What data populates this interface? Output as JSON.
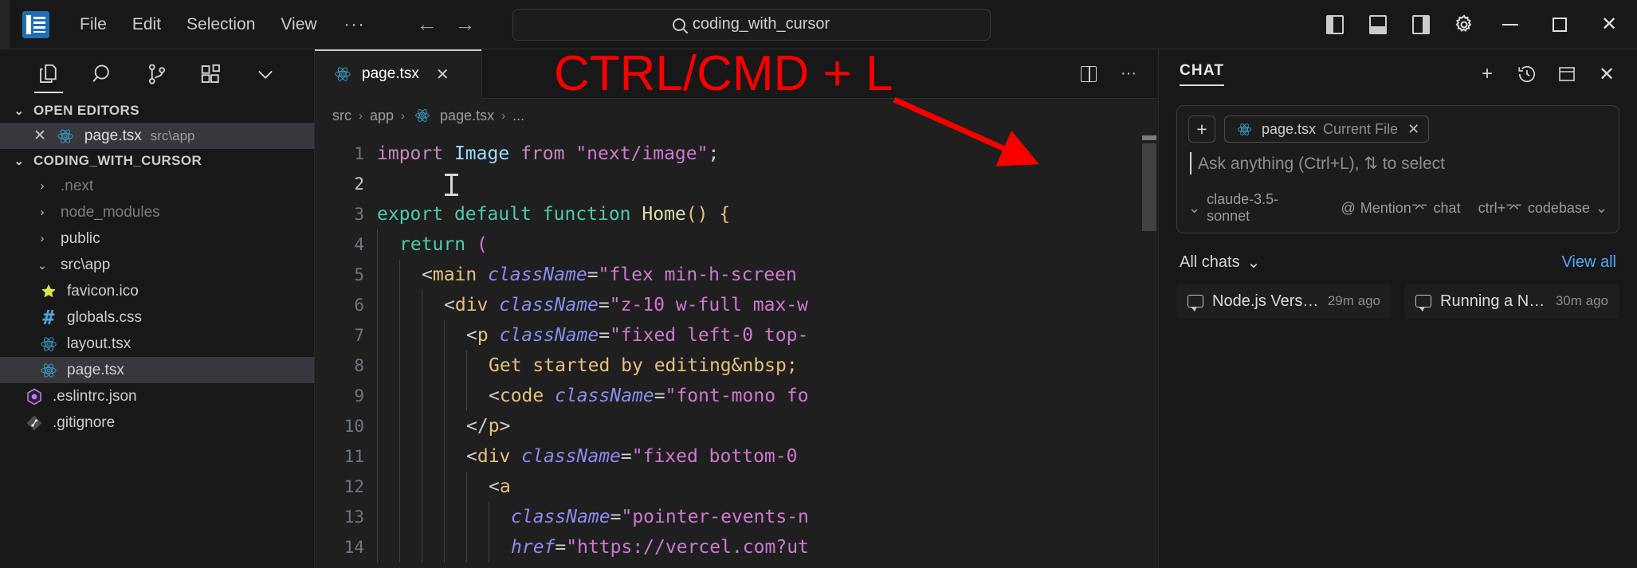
{
  "titlebar": {
    "logo_icon": "cursor-logo-icon",
    "menu": [
      {
        "label": "File"
      },
      {
        "label": "Edit"
      },
      {
        "label": "Selection"
      },
      {
        "label": "View"
      }
    ],
    "more_label": "···",
    "back_icon": "←",
    "forward_icon": "→",
    "search": {
      "value": "coding_with_cursor",
      "icon": "search-icon"
    },
    "layout_icons": [
      "panel-left-icon",
      "panel-bottom-icon",
      "panel-right-icon",
      "gear-icon"
    ],
    "window_controls": {
      "minimize": "─",
      "maximize": "□",
      "close": "✕"
    }
  },
  "sidebar": {
    "activity_icons": [
      "explorer-icon",
      "search-icon",
      "source-control-icon",
      "extensions-icon",
      "chevron-down-icon"
    ],
    "open_editors": {
      "label": "OPEN EDITORS",
      "chevron": "⌄",
      "items": [
        {
          "name": "page.tsx",
          "path": "src\\app",
          "icon": "react-icon",
          "close": "✕",
          "selected": true
        }
      ]
    },
    "workspace": {
      "label": "CODING_WITH_CURSOR",
      "chevron": "⌄",
      "tree": [
        {
          "label": ".next",
          "type": "folder",
          "chevron": "›",
          "dim": true,
          "indent": 1
        },
        {
          "label": "node_modules",
          "type": "folder",
          "chevron": "›",
          "dim": true,
          "indent": 1
        },
        {
          "label": "public",
          "type": "folder",
          "chevron": "›",
          "dim": false,
          "indent": 1
        },
        {
          "label": "src\\app",
          "type": "folder",
          "chevron": "⌄",
          "dim": false,
          "indent": 1,
          "expanded": true
        },
        {
          "label": "favicon.ico",
          "type": "file",
          "icon": "star-icon",
          "indent": 2
        },
        {
          "label": "globals.css",
          "type": "file",
          "icon": "hash-icon",
          "indent": 2
        },
        {
          "label": "layout.tsx",
          "type": "file",
          "icon": "react-icon",
          "indent": 2
        },
        {
          "label": "page.tsx",
          "type": "file",
          "icon": "react-icon",
          "indent": 2,
          "selected": true
        },
        {
          "label": ".eslintrc.json",
          "type": "file",
          "icon": "eslint-icon",
          "indent": 1
        },
        {
          "label": ".gitignore",
          "type": "file",
          "icon": "git-icon",
          "indent": 1
        }
      ]
    }
  },
  "editor": {
    "tab": {
      "label": "page.tsx",
      "icon": "react-icon",
      "close": "✕"
    },
    "actions": [
      "split-editor-icon",
      "more-actions-icon"
    ],
    "breadcrumb": [
      "src",
      "app",
      "page.tsx",
      "..."
    ],
    "breadcrumb_sep": "›",
    "breadcrumb_file_icon": "react-icon",
    "line_numbers": [
      1,
      2,
      3,
      4,
      5,
      6,
      7,
      8,
      9,
      10,
      11,
      12,
      13,
      14
    ],
    "current_line": 2,
    "code_lines": [
      {
        "n": 1,
        "tokens": [
          {
            "t": "import",
            "c": "t-imp"
          },
          {
            "t": " ",
            "c": "t-white"
          },
          {
            "t": "Image",
            "c": "t-id"
          },
          {
            "t": " ",
            "c": "t-white"
          },
          {
            "t": "from",
            "c": "t-imp"
          },
          {
            "t": " ",
            "c": "t-white"
          },
          {
            "t": "\"next/image\"",
            "c": "t-pink"
          },
          {
            "t": ";",
            "c": "t-white"
          }
        ]
      },
      {
        "n": 2,
        "tokens": []
      },
      {
        "n": 3,
        "tokens": [
          {
            "t": "export",
            "c": "t-green"
          },
          {
            "t": " ",
            "c": "t-white"
          },
          {
            "t": "default",
            "c": "t-green"
          },
          {
            "t": " ",
            "c": "t-white"
          },
          {
            "t": "function",
            "c": "t-green"
          },
          {
            "t": " ",
            "c": "t-white"
          },
          {
            "t": "Home",
            "c": "t-fn"
          },
          {
            "t": "()",
            "c": "t-brkt-y"
          },
          {
            "t": " ",
            "c": "t-white"
          },
          {
            "t": "{",
            "c": "t-brkt-y"
          }
        ]
      },
      {
        "n": 4,
        "indent": 1,
        "tokens": [
          {
            "t": "return",
            "c": "t-green"
          },
          {
            "t": " ",
            "c": "t-white"
          },
          {
            "t": "(",
            "c": "t-brkt-p"
          }
        ]
      },
      {
        "n": 5,
        "indent": 2,
        "tokens": [
          {
            "t": "<",
            "c": "t-white"
          },
          {
            "t": "main",
            "c": "t-tag"
          },
          {
            "t": " ",
            "c": "t-white"
          },
          {
            "t": "className",
            "c": "t-attr"
          },
          {
            "t": "=",
            "c": "t-white"
          },
          {
            "t": "\"flex min-h-screen",
            "c": "t-pink"
          }
        ]
      },
      {
        "n": 6,
        "indent": 3,
        "tokens": [
          {
            "t": "<",
            "c": "t-white"
          },
          {
            "t": "div",
            "c": "t-tag"
          },
          {
            "t": " ",
            "c": "t-white"
          },
          {
            "t": "className",
            "c": "t-attr"
          },
          {
            "t": "=",
            "c": "t-white"
          },
          {
            "t": "\"z-10 w-full max-w",
            "c": "t-pink"
          }
        ]
      },
      {
        "n": 7,
        "indent": 4,
        "tokens": [
          {
            "t": "<",
            "c": "t-white"
          },
          {
            "t": "p",
            "c": "t-tag"
          },
          {
            "t": " ",
            "c": "t-white"
          },
          {
            "t": "className",
            "c": "t-attr"
          },
          {
            "t": "=",
            "c": "t-white"
          },
          {
            "t": "\"fixed left-0 top-",
            "c": "t-pink"
          }
        ]
      },
      {
        "n": 8,
        "indent": 5,
        "tokens": [
          {
            "t": "Get started by editing&nbsp;",
            "c": "t-text"
          }
        ]
      },
      {
        "n": 9,
        "indent": 5,
        "tokens": [
          {
            "t": "<",
            "c": "t-white"
          },
          {
            "t": "code",
            "c": "t-tag"
          },
          {
            "t": " ",
            "c": "t-white"
          },
          {
            "t": "className",
            "c": "t-attr"
          },
          {
            "t": "=",
            "c": "t-white"
          },
          {
            "t": "\"font-mono fo",
            "c": "t-pink"
          }
        ]
      },
      {
        "n": 10,
        "indent": 4,
        "tokens": [
          {
            "t": "</",
            "c": "t-white"
          },
          {
            "t": "p",
            "c": "t-tag"
          },
          {
            "t": ">",
            "c": "t-white"
          }
        ]
      },
      {
        "n": 11,
        "indent": 4,
        "tokens": [
          {
            "t": "<",
            "c": "t-white"
          },
          {
            "t": "div",
            "c": "t-tag"
          },
          {
            "t": " ",
            "c": "t-white"
          },
          {
            "t": "className",
            "c": "t-attr"
          },
          {
            "t": "=",
            "c": "t-white"
          },
          {
            "t": "\"fixed bottom-0",
            "c": "t-pink"
          }
        ]
      },
      {
        "n": 12,
        "indent": 5,
        "tokens": [
          {
            "t": "<",
            "c": "t-white"
          },
          {
            "t": "a",
            "c": "t-tag"
          }
        ]
      },
      {
        "n": 13,
        "indent": 6,
        "tokens": [
          {
            "t": "className",
            "c": "t-attr"
          },
          {
            "t": "=",
            "c": "t-white"
          },
          {
            "t": "\"pointer-events-n",
            "c": "t-pink"
          }
        ]
      },
      {
        "n": 14,
        "indent": 6,
        "tokens": [
          {
            "t": "href",
            "c": "t-attr"
          },
          {
            "t": "=",
            "c": "t-white"
          },
          {
            "t": "\"https://vercel.com?ut",
            "c": "t-pink"
          }
        ]
      }
    ]
  },
  "chat": {
    "title": "CHAT",
    "header_actions": [
      "new-chat-icon",
      "history-icon",
      "maximize-chat-icon",
      "close-chat-icon"
    ],
    "header_glyphs": {
      "new": "+",
      "history": "↺",
      "maximize": "⌧",
      "close": "✕"
    },
    "input": {
      "add_context_icon": "plus-icon",
      "add_context_label": "+",
      "context_chip": {
        "file": "page.tsx",
        "tag": "Current File",
        "icon": "react-icon",
        "close": "✕"
      },
      "placeholder": "Ask anything (Ctrl+L), ⇅ to select",
      "model": "claude-3.5-sonnet",
      "model_chevron": "⌄",
      "mention_label": "Mention",
      "mention_icon": "@",
      "mode_label": "chat",
      "mode_icon": "⌤",
      "codebase_label": "codebase",
      "codebase_shortcut": "ctrl+⌤",
      "codebase_chevron": "⌄"
    },
    "history": {
      "all_chats_label": "All chats",
      "all_chats_chevron": "⌄",
      "view_all_label": "View all",
      "items": [
        {
          "title": "Node.js Version ...",
          "time": "29m ago",
          "icon": "chat-bubble-icon"
        },
        {
          "title": "Running a Next.j...",
          "time": "30m ago",
          "icon": "chat-bubble-icon"
        }
      ]
    }
  },
  "annotation": {
    "text": "CTRL/CMD + L",
    "color": "#f80000",
    "arrow_icon": "red-arrow-icon"
  }
}
